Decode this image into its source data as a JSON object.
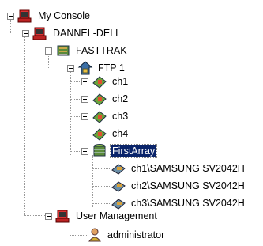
{
  "tree": {
    "root": {
      "label": "My Console",
      "icon": "computer-icon"
    },
    "host": {
      "label": "DANNEL-DELL",
      "icon": "computer-icon"
    },
    "software": {
      "label": "FASTTRAK",
      "icon": "server-icon"
    },
    "controller": {
      "label": "FTP 1",
      "icon": "controller-icon"
    },
    "channels": [
      {
        "label": "ch1",
        "icon": "channel-icon"
      },
      {
        "label": "ch2",
        "icon": "channel-icon"
      },
      {
        "label": "ch3",
        "icon": "channel-icon"
      },
      {
        "label": "ch4",
        "icon": "channel-icon"
      }
    ],
    "array": {
      "label": "FirstArray",
      "icon": "array-icon",
      "selected": true
    },
    "disks": [
      {
        "label": "ch1\\SAMSUNG SV2042H",
        "icon": "disk-icon"
      },
      {
        "label": "ch2\\SAMSUNG SV2042H",
        "icon": "disk-icon"
      },
      {
        "label": "ch3\\SAMSUNG SV2042H",
        "icon": "disk-icon"
      }
    ],
    "user_mgmt": {
      "label": "User Management",
      "icon": "computer-icon"
    },
    "admin": {
      "label": "administrator",
      "icon": "user-icon"
    }
  },
  "colors": {
    "selection": "#0a246a",
    "tree_line": "#999999"
  }
}
